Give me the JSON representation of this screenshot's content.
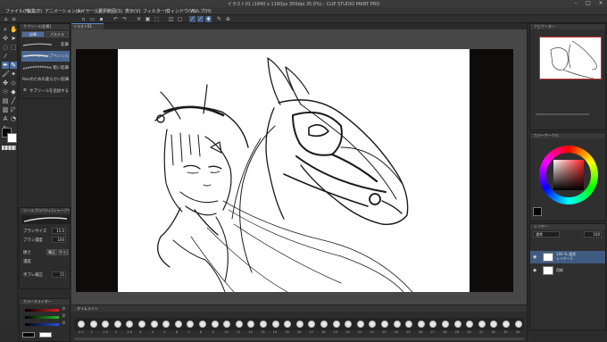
{
  "window": {
    "title": "イラスト01 (1840 x 1160px 350dpi 35.0%) - CLIP STUDIO PAINT PRO",
    "controls": [
      "–",
      "□",
      "×"
    ]
  },
  "menu": [
    "ファイル(F)",
    "編集(E)",
    "アニメーション(A)",
    "レイヤー(L)",
    "選択範囲(S)",
    "表示(V)",
    "フィルター(I)",
    "ウィンドウ(W)",
    "ヘルプ(H)"
  ],
  "canvas_tab": {
    "label": "イラスト01"
  },
  "tools": {
    "colors": {
      "main": "#0a0a0a",
      "sub": "#ffffff",
      "active": "#4c6e9f"
    }
  },
  "sub_tool_panel": {
    "header": "サブツール[鉛筆]",
    "tabs": [
      "鉛筆",
      "パステル"
    ],
    "items": [
      {
        "label": "鉛筆"
      },
      {
        "label": "シャープペンシル",
        "selected": true
      },
      {
        "label": "粗い鉛筆"
      },
      {
        "label": "Renのための柔らかい鉛筆"
      }
    ],
    "add_label": "サブツールを追加する"
  },
  "tool_property": {
    "header": "ツールプロパティ[シャープペンシル]",
    "rows": [
      {
        "label": "ブラシサイズ",
        "value": "15.0"
      },
      {
        "label": "ブラシ濃度",
        "value": "100"
      },
      {
        "label": "硬さ",
        "value": ""
      },
      {
        "label": "手ブレ補正",
        "value": "15"
      }
    ],
    "pressure_labels": [
      "筆圧",
      "サイズ",
      "濃度"
    ]
  },
  "color_slider": {
    "header": "カラースライダー",
    "values": {
      "r": "0",
      "g": "0",
      "b": "0"
    }
  },
  "timeline": {
    "header": "タイムライン",
    "frames": [
      "0.2",
      "1",
      "1.5",
      "2",
      "2.5",
      "3",
      "4",
      "5",
      "6",
      "7",
      "8",
      "9",
      "10",
      "11",
      "12",
      "13",
      "14",
      "15",
      "16",
      "17",
      "18",
      "19",
      "20",
      "21",
      "22",
      "23",
      "24",
      "25",
      "26",
      "27",
      "28",
      "29",
      "30",
      "31",
      "32",
      "33",
      "34"
    ]
  },
  "right": {
    "navigator_header": "ナビゲーター",
    "color_wheel_header": "カラーサークル",
    "layer_header": "レイヤー",
    "layer_blend": "通常",
    "layer_opacity": "100",
    "layers": [
      {
        "name": "100 % 通常",
        "sub": "レイヤー1",
        "selected": true
      },
      {
        "name": "用紙",
        "sub": "",
        "selected": false
      }
    ]
  }
}
